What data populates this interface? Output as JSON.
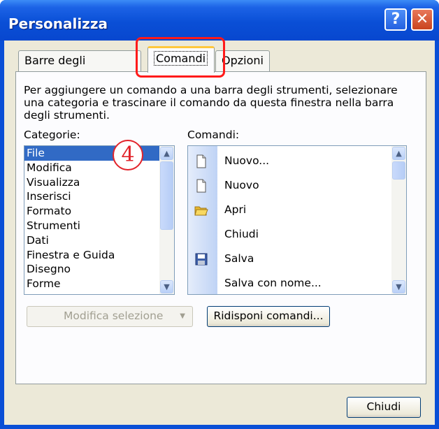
{
  "window": {
    "title": "Personalizza",
    "help_glyph": "?",
    "close_glyph": "✕"
  },
  "tabs": [
    {
      "label": "Barre degli strumenti"
    },
    {
      "label": "Comandi"
    },
    {
      "label": "Opzioni"
    }
  ],
  "description": "Per aggiungere un comando a una barra degli strumenti, selezionare una categoria e trascinare il comando da questa finestra nella barra degli strumenti.",
  "categories": {
    "label": "Categorie:",
    "items": [
      "File",
      "Modifica",
      "Visualizza",
      "Inserisci",
      "Formato",
      "Strumenti",
      "Dati",
      "Finestra e Guida",
      "Disegno",
      "Forme"
    ],
    "selected": "File"
  },
  "commands": {
    "label": "Comandi:",
    "items": [
      {
        "label": "Nuovo...",
        "icon": "new-document-icon"
      },
      {
        "label": "Nuovo",
        "icon": "new-document-icon"
      },
      {
        "label": "Apri",
        "icon": "open-folder-icon"
      },
      {
        "label": "Chiudi",
        "icon": ""
      },
      {
        "label": "Salva",
        "icon": "save-disk-icon"
      },
      {
        "label": "Salva con nome...",
        "icon": ""
      }
    ]
  },
  "buttons": {
    "modify_selection": "Modifica selezione",
    "rearrange": "Ridisponi comandi...",
    "close": "Chiudi"
  },
  "annotation": {
    "step_number": "4"
  },
  "colors": {
    "selection": "#316ac5",
    "annotation_red": "#ff1a1a",
    "title_blue": "#0a4fd6"
  }
}
